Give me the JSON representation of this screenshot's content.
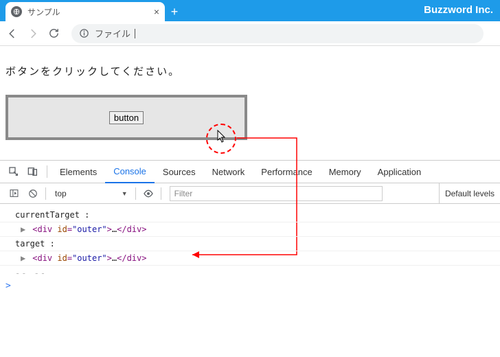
{
  "watermark": "Buzzword Inc.",
  "tab": {
    "title": "サンプル"
  },
  "address": {
    "label": "ファイル"
  },
  "page": {
    "instruction": "ボタンをクリックしてください。",
    "button_label": "button"
  },
  "devtools": {
    "tabs": {
      "elements": "Elements",
      "console": "Console",
      "sources": "Sources",
      "network": "Network",
      "performance": "Performance",
      "memory": "Memory",
      "application": "Application"
    },
    "context": "top",
    "filter_placeholder": "Filter",
    "levels": "Default levels",
    "lines": {
      "l1": "currentTarget :",
      "l3": "target :",
      "tag": "div",
      "attr": "id",
      "val": "\"outer\"",
      "ell": "…",
      "dashes": "-- --",
      "prompt": ">"
    }
  }
}
